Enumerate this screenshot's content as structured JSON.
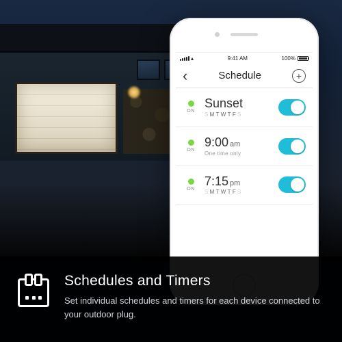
{
  "bottom": {
    "title": "Schedules and Timers",
    "desc": "Set individual schedules and timers for each device connected to your outdoor plug."
  },
  "status": {
    "signal_dots": 5,
    "wifi": "▴",
    "time": "9:41 AM",
    "battery": "100%"
  },
  "nav": {
    "back": "‹",
    "title": "Schedule",
    "add": "+"
  },
  "rows": [
    {
      "on_label": "ON",
      "title": "Sunset",
      "days": [
        "S",
        "M",
        "T",
        "W",
        "T",
        "F",
        "S"
      ],
      "active_days": [
        1,
        2,
        3,
        4,
        5
      ],
      "toggle": true
    },
    {
      "on_label": "ON",
      "title": "9:00",
      "ampm": "am",
      "subtitle": "One time only",
      "toggle": true
    },
    {
      "on_label": "ON",
      "title": "7:15",
      "ampm": "pm",
      "days": [
        "S",
        "M",
        "T",
        "W",
        "T",
        "F",
        "S"
      ],
      "active_days": [
        1,
        2,
        3,
        4,
        5
      ],
      "toggle": true
    }
  ]
}
